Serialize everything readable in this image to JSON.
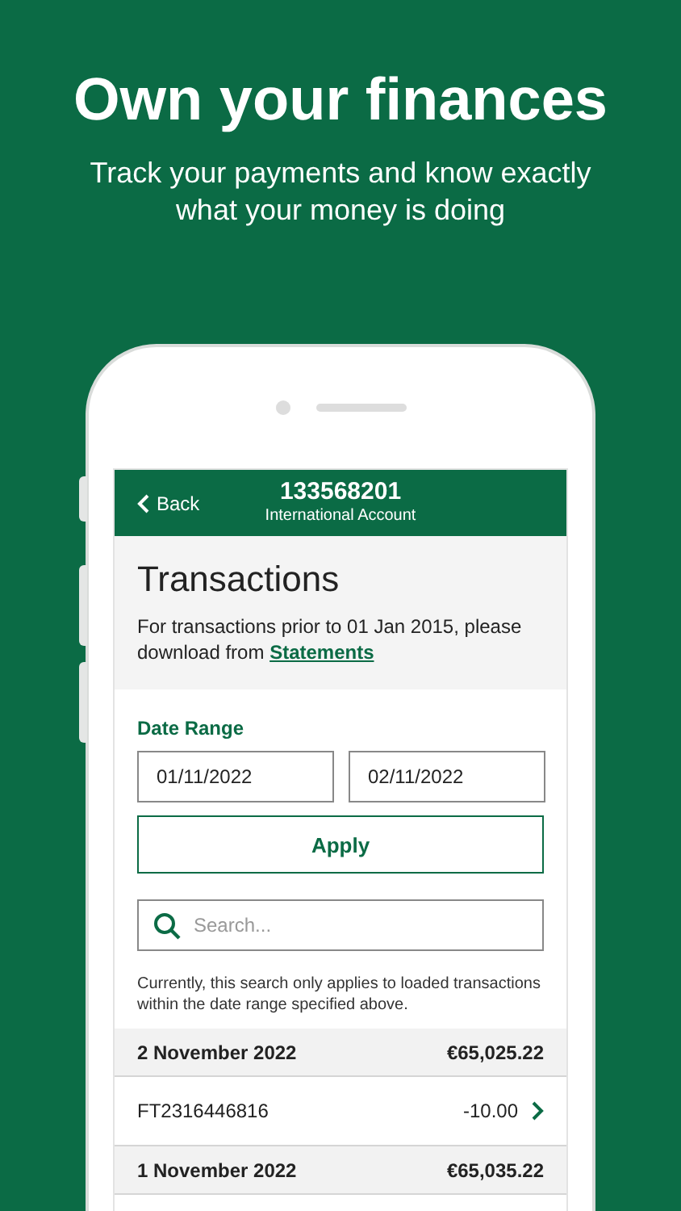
{
  "headline": "Own your finances",
  "subtitle": "Track your payments and know exactly what your money is doing",
  "header": {
    "back": "Back",
    "account_number": "133568201",
    "account_name": "International Account"
  },
  "title": "Transactions",
  "notice": {
    "text": "For transactions prior to 01 Jan 2015, please download from",
    "link": "Statements"
  },
  "date_range": {
    "label": "Date Range",
    "from": "01/11/2022",
    "to": "02/11/2022"
  },
  "apply": "Apply",
  "search": {
    "placeholder": "Search..."
  },
  "note": "Currently, this search only applies to loaded transactions within the date range specified above.",
  "days": [
    {
      "date": "2 November 2022",
      "balance": "€65,025.22",
      "items": [
        {
          "reference": "FT2316446816",
          "amount": "-10.00"
        }
      ]
    },
    {
      "date": "1 November 2022",
      "balance": "€65,035.22"
    }
  ]
}
